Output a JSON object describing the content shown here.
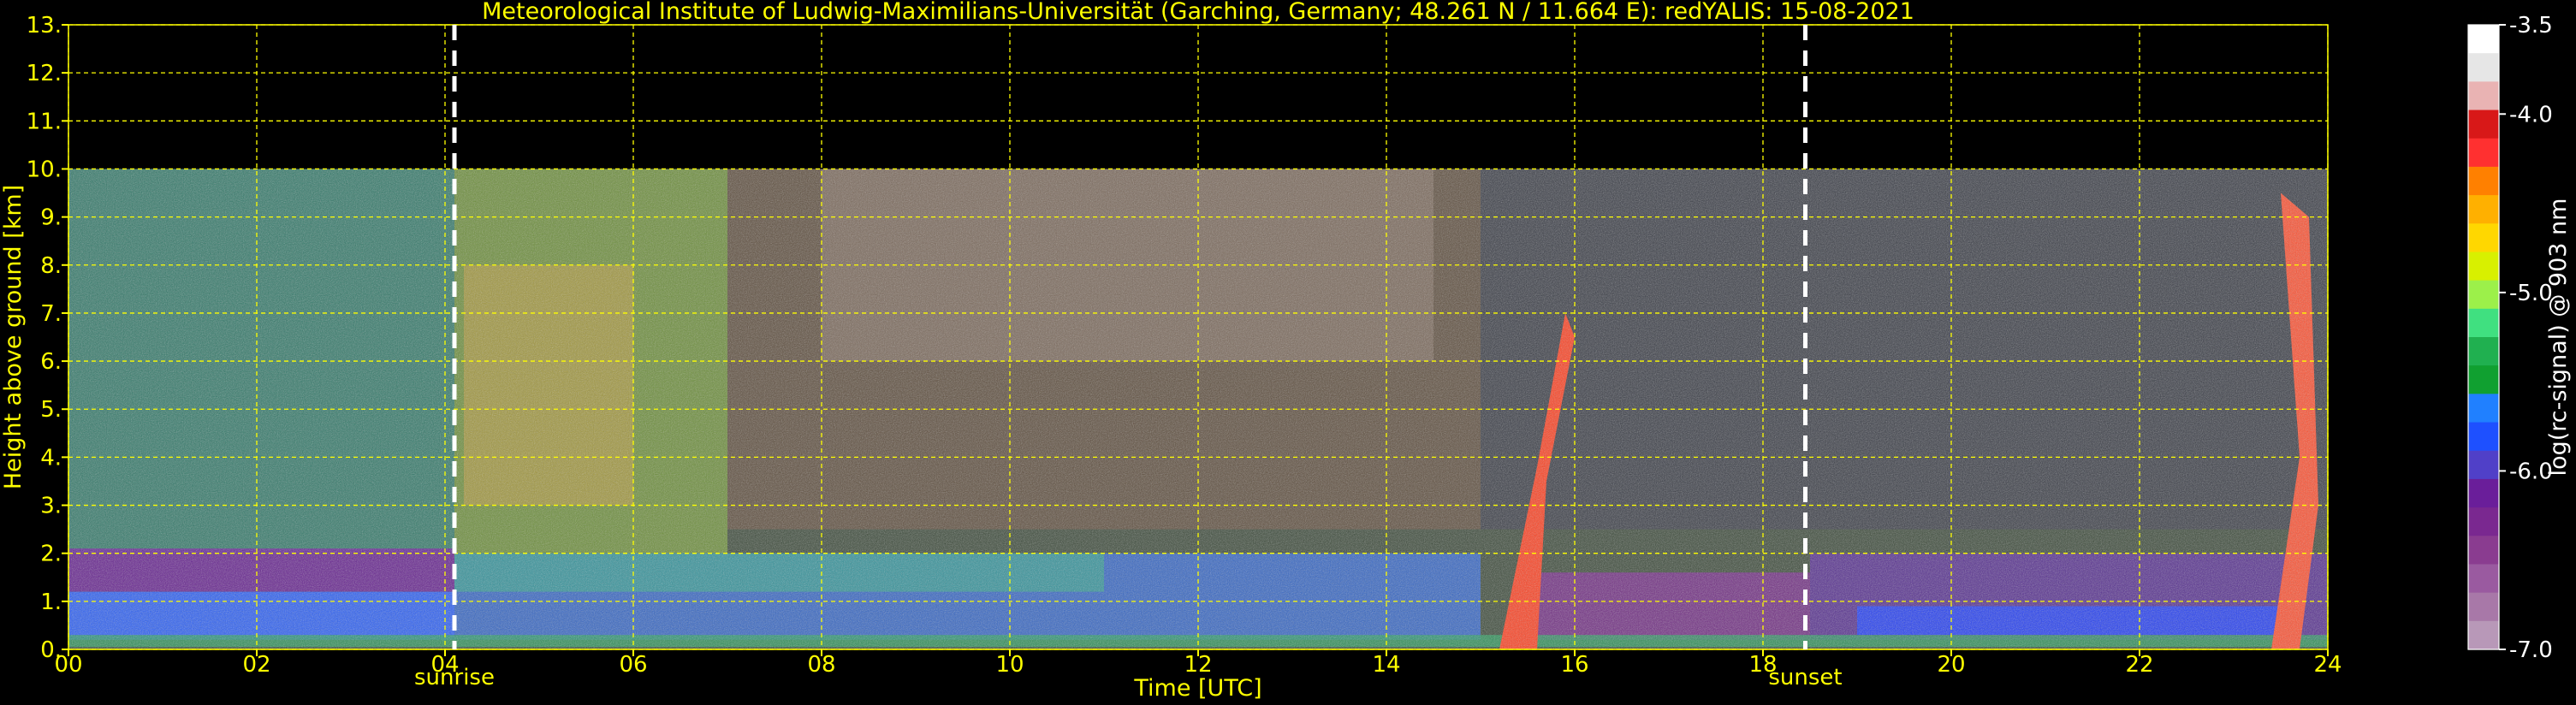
{
  "chart_data": {
    "type": "heatmap",
    "title": "Meteorological Institute of Ludwig-Maximilians-Universität (Garching, Germany; 48.261 N / 11.664 E):    redYALIS: 15-08-2021",
    "xlabel": "Time [UTC]",
    "ylabel": "Height above ground [km]",
    "xlim": [
      0,
      24
    ],
    "ylim": [
      0,
      13
    ],
    "x_ticks": [
      "00",
      "02",
      "04",
      "06",
      "08",
      "10",
      "12",
      "14",
      "16",
      "18",
      "20",
      "22",
      "24"
    ],
    "y_ticks": [
      "0.",
      "1.",
      "2.",
      "3.",
      "4.",
      "5.",
      "6.",
      "7.",
      "8.",
      "9.",
      "10.",
      "11.",
      "12.",
      "13."
    ],
    "grid": true,
    "data_top_km": 10,
    "events": [
      {
        "label": "sunrise",
        "time": 4.1
      },
      {
        "label": "sunset",
        "time": 18.45
      }
    ],
    "colorbar": {
      "label": "log(rc-signal) @ 903 nm",
      "range": [
        -7.0,
        -3.5
      ],
      "ticks": [
        "-3.5",
        "-4.0",
        "-5.0",
        "-6.0",
        "-7.0"
      ],
      "tick_values": [
        -3.5,
        -4.0,
        -5.0,
        -6.0,
        -7.0
      ],
      "colors": [
        "#ffffff",
        "#e6e6e6",
        "#e9b3b3",
        "#d81818",
        "#ff3030",
        "#ff8000",
        "#ffb000",
        "#ffd700",
        "#d8f000",
        "#9cf04a",
        "#40e080",
        "#20b050",
        "#10a030",
        "#2080ff",
        "#1e50ff",
        "#5040c8",
        "#6a1e9a",
        "#7a2890",
        "#8a3c90",
        "#9a5aa0",
        "#a878a8",
        "#b898b8"
      ]
    }
  }
}
